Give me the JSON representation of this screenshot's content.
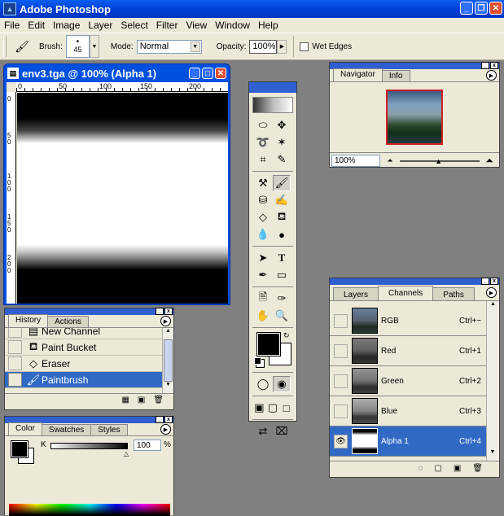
{
  "app": {
    "title": "Adobe Photoshop",
    "icon": "photoshop-icon"
  },
  "menu": [
    "File",
    "Edit",
    "Image",
    "Layer",
    "Select",
    "Filter",
    "View",
    "Window",
    "Help"
  ],
  "options": {
    "brush_label": "Brush:",
    "brush_size": "45",
    "mode_label": "Mode:",
    "mode_value": "Normal",
    "opacity_label": "Opacity:",
    "opacity_value": "100%",
    "wet_edges_label": "Wet Edges"
  },
  "document": {
    "title": "env3.tga @ 100% (Alpha 1)",
    "ruler_h": [
      "0",
      "50",
      "100",
      "150",
      "200"
    ],
    "ruler_v": [
      "0",
      "50",
      "100",
      "150",
      "200"
    ]
  },
  "navigator": {
    "tabs": [
      "Navigator",
      "Info"
    ],
    "zoom": "100%"
  },
  "history": {
    "tabs": [
      "History",
      "Actions"
    ],
    "items": [
      {
        "label": "New Channel",
        "icon": "document-icon"
      },
      {
        "label": "Paint Bucket",
        "icon": "paint-bucket-icon"
      },
      {
        "label": "Eraser",
        "icon": "eraser-icon"
      },
      {
        "label": "Paintbrush",
        "icon": "paintbrush-icon"
      }
    ],
    "active_index": 3
  },
  "color": {
    "tabs": [
      "Color",
      "Swatches",
      "Styles"
    ],
    "channel": "K",
    "value": "100",
    "unit": "%"
  },
  "channels": {
    "tabs": [
      "Layers",
      "Channels",
      "Paths"
    ],
    "rows": [
      {
        "name": "RGB",
        "shortcut": "Ctrl+~",
        "visible": false
      },
      {
        "name": "Red",
        "shortcut": "Ctrl+1",
        "visible": false
      },
      {
        "name": "Green",
        "shortcut": "Ctrl+2",
        "visible": false
      },
      {
        "name": "Blue",
        "shortcut": "Ctrl+3",
        "visible": false
      },
      {
        "name": "Alpha 1",
        "shortcut": "Ctrl+4",
        "visible": true
      }
    ],
    "active_index": 4
  },
  "colors": {
    "accent": "#316ac5",
    "titlebar": "#0a5ff0",
    "panel": "#ece9d8"
  }
}
